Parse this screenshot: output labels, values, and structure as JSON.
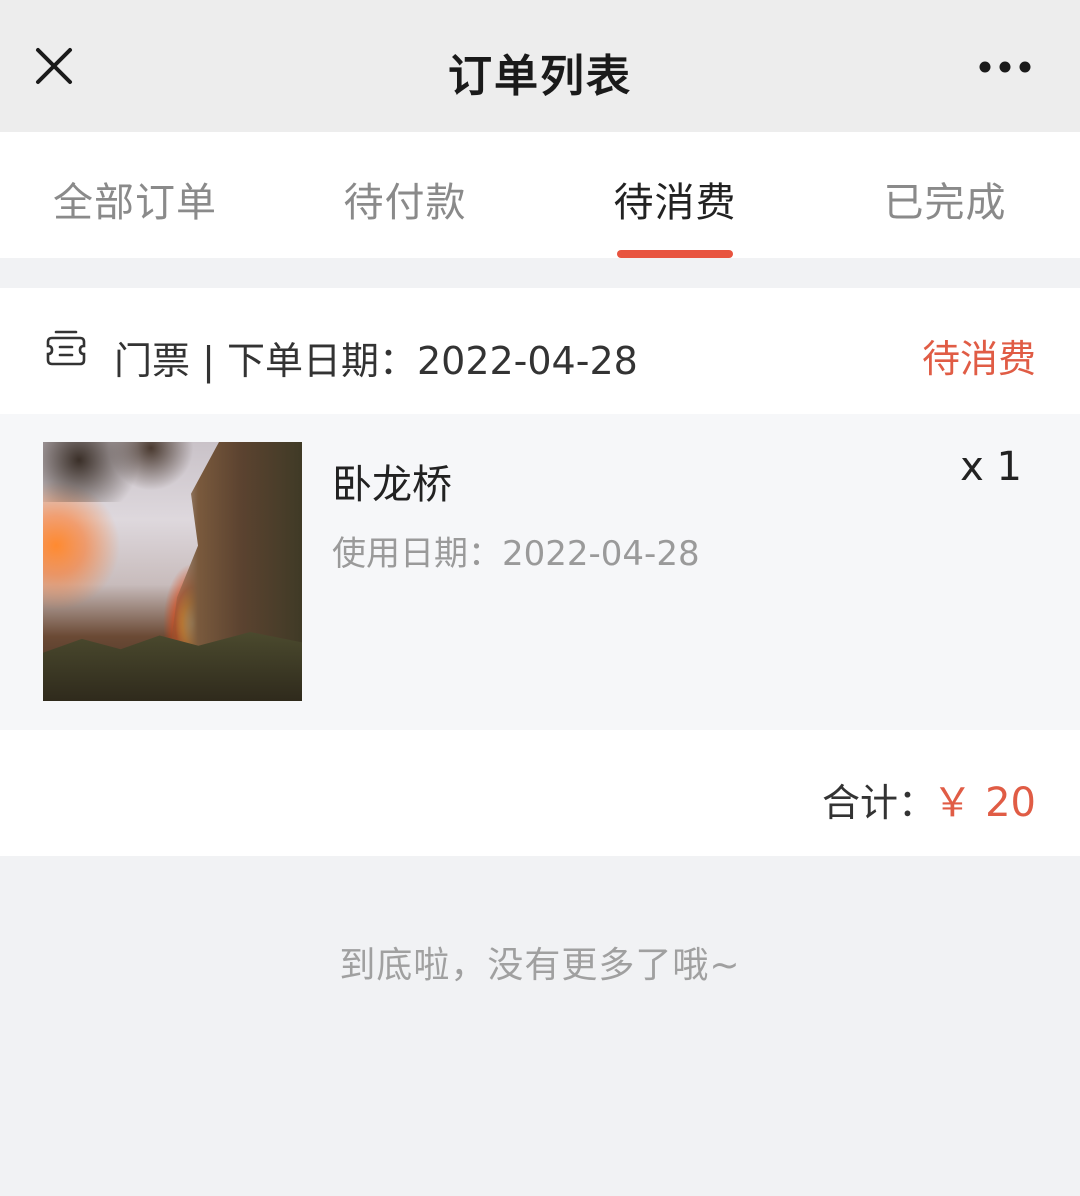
{
  "nav": {
    "title": "订单列表",
    "close_icon": "close-icon",
    "more_icon": "more-horizontal-icon"
  },
  "tabs": [
    {
      "label": "全部订单",
      "active": false
    },
    {
      "label": "待付款",
      "active": false
    },
    {
      "label": "待消费",
      "active": true
    },
    {
      "label": "已完成",
      "active": false
    }
  ],
  "order": {
    "type_icon": "ticket-icon",
    "header_text": "门票 | 下单日期：2022-04-28",
    "status": "待消费",
    "item": {
      "name": "卧龙桥",
      "use_date": "使用日期：2022-04-28",
      "quantity": "x 1",
      "image": "scenic-photo"
    },
    "total_label": "合计：",
    "total_amount": "￥ 20"
  },
  "footer": {
    "end_text": "到底啦，没有更多了哦~"
  },
  "colors": {
    "accent": "#e8543f",
    "status": "#e05c45",
    "nav_bg": "#ededed",
    "page_bg": "#f1f2f4"
  }
}
